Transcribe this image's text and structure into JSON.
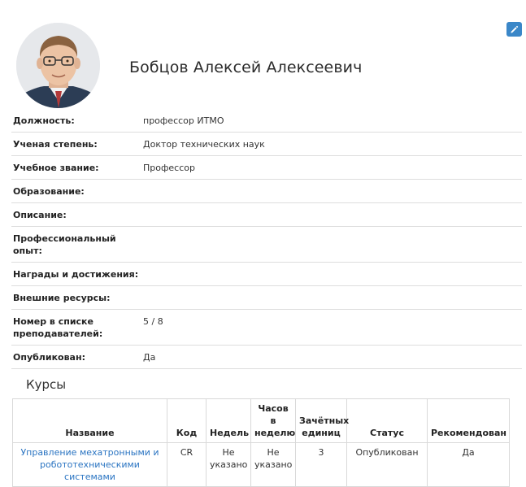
{
  "profile": {
    "name": "Бобцов Алексей Алексеевич",
    "edit_icon": "pencil-icon",
    "avatar_icon": "person-photo"
  },
  "fields": [
    {
      "label": "Должность:",
      "value": "профессор ИТМО"
    },
    {
      "label": "Ученая степень:",
      "value": "Доктор технических наук"
    },
    {
      "label": "Учебное звание:",
      "value": "Профессор"
    },
    {
      "label": "Образование:",
      "value": ""
    },
    {
      "label": "Описание:",
      "value": ""
    },
    {
      "label": "Профессиональный опыт:",
      "value": ""
    },
    {
      "label": "Награды и достижения:",
      "value": ""
    },
    {
      "label": "Внешние ресурсы:",
      "value": ""
    },
    {
      "label": "Номер в списке преподавателей:",
      "value": "5 / 8"
    },
    {
      "label": "Опубликован:",
      "value": "Да"
    }
  ],
  "courses": {
    "title": "Курсы",
    "headers": [
      "Название",
      "Код",
      "Недель",
      "Часов в неделю",
      "Зачётных единиц",
      "Статус",
      "Рекомендован"
    ],
    "rows": [
      {
        "name": "Управление мехатронными и робототехническими системами",
        "code": "CR",
        "weeks": "Не указано",
        "hours": "Не указано",
        "credits": "3",
        "status": "Опубликован",
        "recommended": "Да"
      }
    ]
  },
  "colors": {
    "accent": "#3a87c8",
    "link": "#2a74c2",
    "border": "#dddddd"
  }
}
